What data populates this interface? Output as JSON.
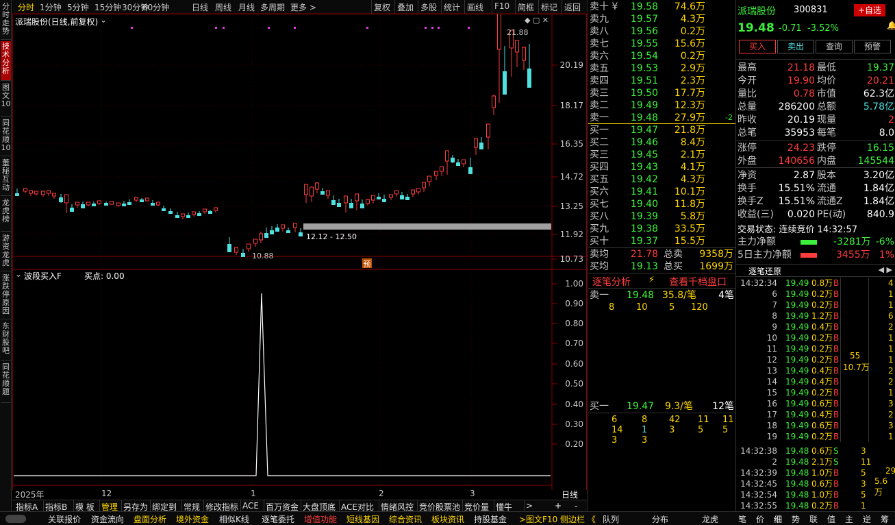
{
  "sidebar": [
    "分时走势",
    "技术分析",
    "图文10",
    "同花顺10",
    "董秘互动",
    "龙虎榜",
    "游资龙虎",
    "涨跌停原因",
    "东财股吧",
    "同花顺题"
  ],
  "topbar": {
    "periods": [
      "分时",
      "1分钟",
      "5分钟",
      "15分钟",
      "30分钟",
      "60分钟",
      "日线",
      "周线",
      "月线",
      "多周期",
      "更多 >"
    ],
    "tools": [
      "复权",
      "叠加",
      "多股",
      "统计",
      "画线",
      "F10",
      "简框",
      "标记",
      "返回"
    ]
  },
  "chart": {
    "title": "派瑞股份(日线,前复权)",
    "axis": [
      "20.19",
      "18.17",
      "16.35",
      "14.72",
      "13.25",
      "11.92",
      "10.73"
    ],
    "high_label": "21.88",
    "low_label": "10.88",
    "range_label": "12.12 - 12.50",
    "yu_label": "预",
    "indicator_title": "波段买入F",
    "indicator_value": "买点: 0.00",
    "ind_axis": [
      "1.00",
      "0.90",
      "0.80",
      "0.70",
      "0.60",
      "0.50",
      "0.40",
      "0.30",
      "0.20"
    ],
    "xlabels": [
      "2025年",
      "12",
      "1",
      "2",
      "3"
    ],
    "period_label": "日线"
  },
  "botbar": [
    "指标A",
    "指标B",
    "模 板",
    "管理",
    "另存为",
    "绑定到",
    "常规",
    "修改指标",
    "ACE",
    "百万资金",
    "大盘顶底",
    "ACE对比",
    "情绪风控",
    "竞价股票池",
    "竞价量",
    "懂牛",
    ">"
  ],
  "statusbar": [
    "关联报价",
    "资金流向",
    "盘面分析",
    "境外资金",
    "相似K线",
    "逐笔委托",
    "增值功能",
    "短线基因",
    "综合资讯",
    "板块资讯",
    "持股基金",
    ">图文F10 侧边栏 《",
    "队列",
    "分布",
    "龙虎",
    "笔",
    "价",
    "细",
    "势",
    "联",
    "值",
    "主",
    "逆",
    "筹"
  ],
  "book": {
    "asks": [
      [
        "卖十 ¥",
        "19.58",
        "74.6万"
      ],
      [
        "卖九",
        "19.57",
        "4.3万"
      ],
      [
        "卖八",
        "19.56",
        "0.2万"
      ],
      [
        "卖七",
        "19.55",
        "15.6万"
      ],
      [
        "卖六",
        "19.54",
        "0.2万"
      ],
      [
        "卖五",
        "19.53",
        "2.9万"
      ],
      [
        "卖四",
        "19.51",
        "2.3万"
      ],
      [
        "卖三",
        "19.50",
        "17.7万"
      ],
      [
        "卖二",
        "19.49",
        "12.3万"
      ],
      [
        "卖一",
        "19.48",
        "27.9万"
      ]
    ],
    "ask1_change": "-2",
    "bids": [
      [
        "买一",
        "19.47",
        "21.8万"
      ],
      [
        "买二",
        "19.46",
        "8.4万"
      ],
      [
        "买三",
        "19.45",
        "2.1万"
      ],
      [
        "买四",
        "19.43",
        "4.1万"
      ],
      [
        "买五",
        "19.42",
        "4.3万"
      ],
      [
        "买六",
        "19.41",
        "10.1万"
      ],
      [
        "买七",
        "19.40",
        "11.8万"
      ],
      [
        "买八",
        "19.39",
        "5.8万"
      ],
      [
        "买九",
        "19.38",
        "33.5万"
      ],
      [
        "买十",
        "19.37",
        "15.5万"
      ]
    ],
    "avg": [
      [
        "卖均",
        "21.78",
        "总卖",
        "9358万"
      ],
      [
        "买均",
        "19.13",
        "总买",
        "1699万"
      ]
    ],
    "tab1": "逐笔分析",
    "tab2": "查看千档盘口",
    "sell1": {
      "label": "卖一",
      "price": "19.48",
      "vol": "35.8/笔",
      "count": "4笔"
    },
    "sell1_orders": [
      "8",
      "10",
      "5",
      "120"
    ],
    "buy1": {
      "label": "买一",
      "price": "19.47",
      "vol": "9.3/笔",
      "count": "12笔"
    },
    "buy1_orders": [
      [
        "6",
        "8",
        "42",
        "11",
        "11"
      ],
      [
        "14",
        "1",
        "3",
        "5",
        "5"
      ],
      [
        "3",
        "3"
      ]
    ]
  },
  "quote": {
    "name": "派瑞股份",
    "code": "300831",
    "add": "+自选",
    "price": "19.48",
    "chg": "-0.71",
    "pct": "-3.52%",
    "buttons": [
      "买入",
      "卖出",
      "查询",
      "预警"
    ],
    "rows": [
      [
        "最高",
        "21.18",
        "最低",
        "19.37"
      ],
      [
        "今开",
        "19.90",
        "均价",
        "20.21"
      ],
      [
        "量比",
        "0.78",
        "市值",
        "62.3亿"
      ],
      [
        "总量",
        "286200",
        "总额",
        "5.78亿"
      ],
      [
        "昨收",
        "20.19",
        "现量",
        "2"
      ],
      [
        "总笔",
        "35953",
        "每笔",
        "8.0"
      ],
      [
        "涨停",
        "24.23",
        "跌停",
        "16.15"
      ],
      [
        "外盘",
        "140656",
        "内盘",
        "145544"
      ],
      [
        "净资",
        "2.87",
        "股本",
        "3.20亿"
      ],
      [
        "换手",
        "15.51%",
        "流通",
        "1.84亿"
      ],
      [
        "换手Z",
        "15.51%",
        "流通Z",
        "1.84亿"
      ],
      [
        "收益(三)",
        "0.020",
        "PE(动)",
        "840.9"
      ]
    ],
    "state": "交易状态: 连续竞价 14:32:57",
    "flow1": [
      "主力净额",
      "-3281万",
      "-6%"
    ],
    "flow2": [
      "5日主力净额",
      "3455万",
      "1%"
    ],
    "tick_title": "逐笔还原",
    "ticks": [
      [
        "14:32:34",
        "19.49",
        "0.8万",
        "B",
        "4"
      ],
      [
        "6",
        "19.49",
        "0.2万",
        "B",
        "1"
      ],
      [
        "7",
        "19.49",
        "0.2万",
        "B",
        "1"
      ],
      [
        "8",
        "19.49",
        "1.2万",
        "B",
        "6"
      ],
      [
        "9",
        "19.49",
        "0.4万",
        "B",
        "2"
      ],
      [
        "10",
        "19.49",
        "0.2万",
        "B",
        "1"
      ],
      [
        "11",
        "19.49",
        "0.2万",
        "B",
        "1"
      ],
      [
        "12",
        "19.49",
        "0.2万",
        "B",
        "1"
      ],
      [
        "13",
        "19.49",
        "0.4万",
        "B",
        "2"
      ],
      [
        "14",
        "19.49",
        "0.4万",
        "B",
        "2"
      ],
      [
        "15",
        "19.49",
        "0.2万",
        "B",
        "1"
      ],
      [
        "16",
        "19.49",
        "0.6万",
        "B",
        "3"
      ],
      [
        "17",
        "19.49",
        "0.4万",
        "B",
        "2"
      ],
      [
        "18",
        "19.49",
        "0.6万",
        "B",
        "3"
      ],
      [
        "19",
        "19.49",
        "0.2万",
        "B",
        "1"
      ],
      [
        "14:32:38",
        "19.48",
        "0.6万",
        "S",
        "3"
      ],
      [
        "2",
        "19.48",
        "2.1万",
        "S",
        "11"
      ],
      [
        "14:32:39",
        "19.48",
        "1.0万",
        "B",
        "5"
      ],
      [
        "14:32:45",
        "19.48",
        "0.6万",
        "B",
        "3"
      ],
      [
        "14:32:54",
        "19.48",
        "1.0万",
        "B",
        "5"
      ],
      [
        "14:32:55",
        "19.48",
        "0.2万",
        "B",
        "1"
      ]
    ],
    "tick_group1": [
      "55",
      "10.7万"
    ],
    "tick_group2": [
      "29",
      "5.6万"
    ]
  }
}
